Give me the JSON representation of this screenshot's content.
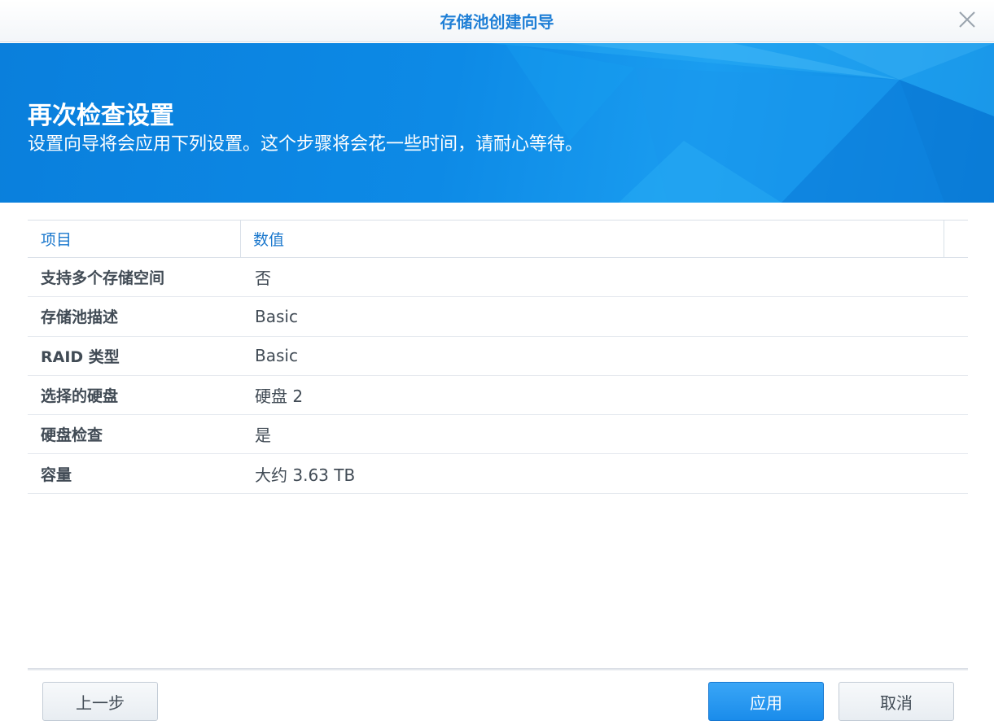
{
  "window": {
    "title": "存储池创建向导",
    "close_icon": "close-icon"
  },
  "banner": {
    "heading": "再次检查设置",
    "subheading": "设置向导将会应用下列设置。这个步骤将会花一些时间，请耐心等待。"
  },
  "table": {
    "columns": [
      "项目",
      "数值"
    ],
    "rows": [
      {
        "key": "支持多个存储空间",
        "value": "否"
      },
      {
        "key": "存储池描述",
        "value": "Basic"
      },
      {
        "key": "RAID 类型",
        "value": "Basic"
      },
      {
        "key": "选择的硬盘",
        "value": "硬盘 2"
      },
      {
        "key": "硬盘检查",
        "value": "是"
      },
      {
        "key": "容量",
        "value": "大约 3.63 TB"
      }
    ]
  },
  "footer": {
    "prev_label": "上一步",
    "apply_label": "应用",
    "cancel_label": "取消"
  },
  "colors": {
    "accent": "#1f7fd6",
    "banner": "#0d8ae6",
    "primary_button": "#2598ef"
  }
}
